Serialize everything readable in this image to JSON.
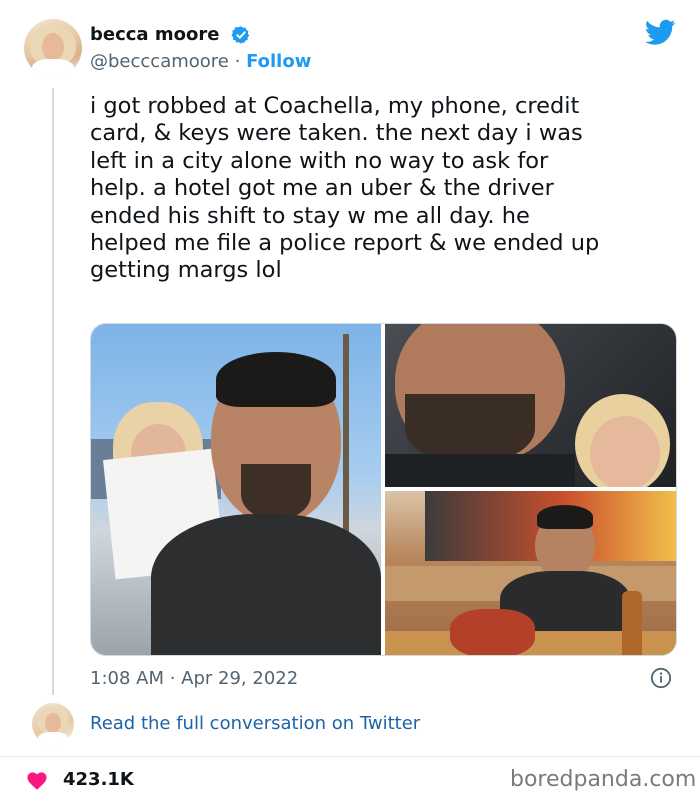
{
  "author": {
    "name": "becca moore",
    "handle": "@becccamoore",
    "separator": "·",
    "follow_label": "Follow"
  },
  "tweet": {
    "text": "i got robbed at Coachella, my phone, credit\ncard, & keys were taken. the next day i was\nleft in a city alone with no way to ask for\nhelp. a hotel got me an uber & the driver\nended his shift to stay w me all day. he\nhelped me file a police report & we ended up\ngetting margs lol",
    "timestamp": "1:08 AM · Apr 29, 2022"
  },
  "footer": {
    "read_link": "Read the full conversation on Twitter",
    "likes": "423.1K",
    "watermark": "boredpanda.com"
  },
  "colors": {
    "accent": "#1d9bf0",
    "heart": "#f91880",
    "secondary_text": "#536471"
  },
  "icons": {
    "verified": "verified-badge-icon",
    "brand": "twitter-bird-icon",
    "info": "info-icon",
    "like": "heart-icon"
  }
}
